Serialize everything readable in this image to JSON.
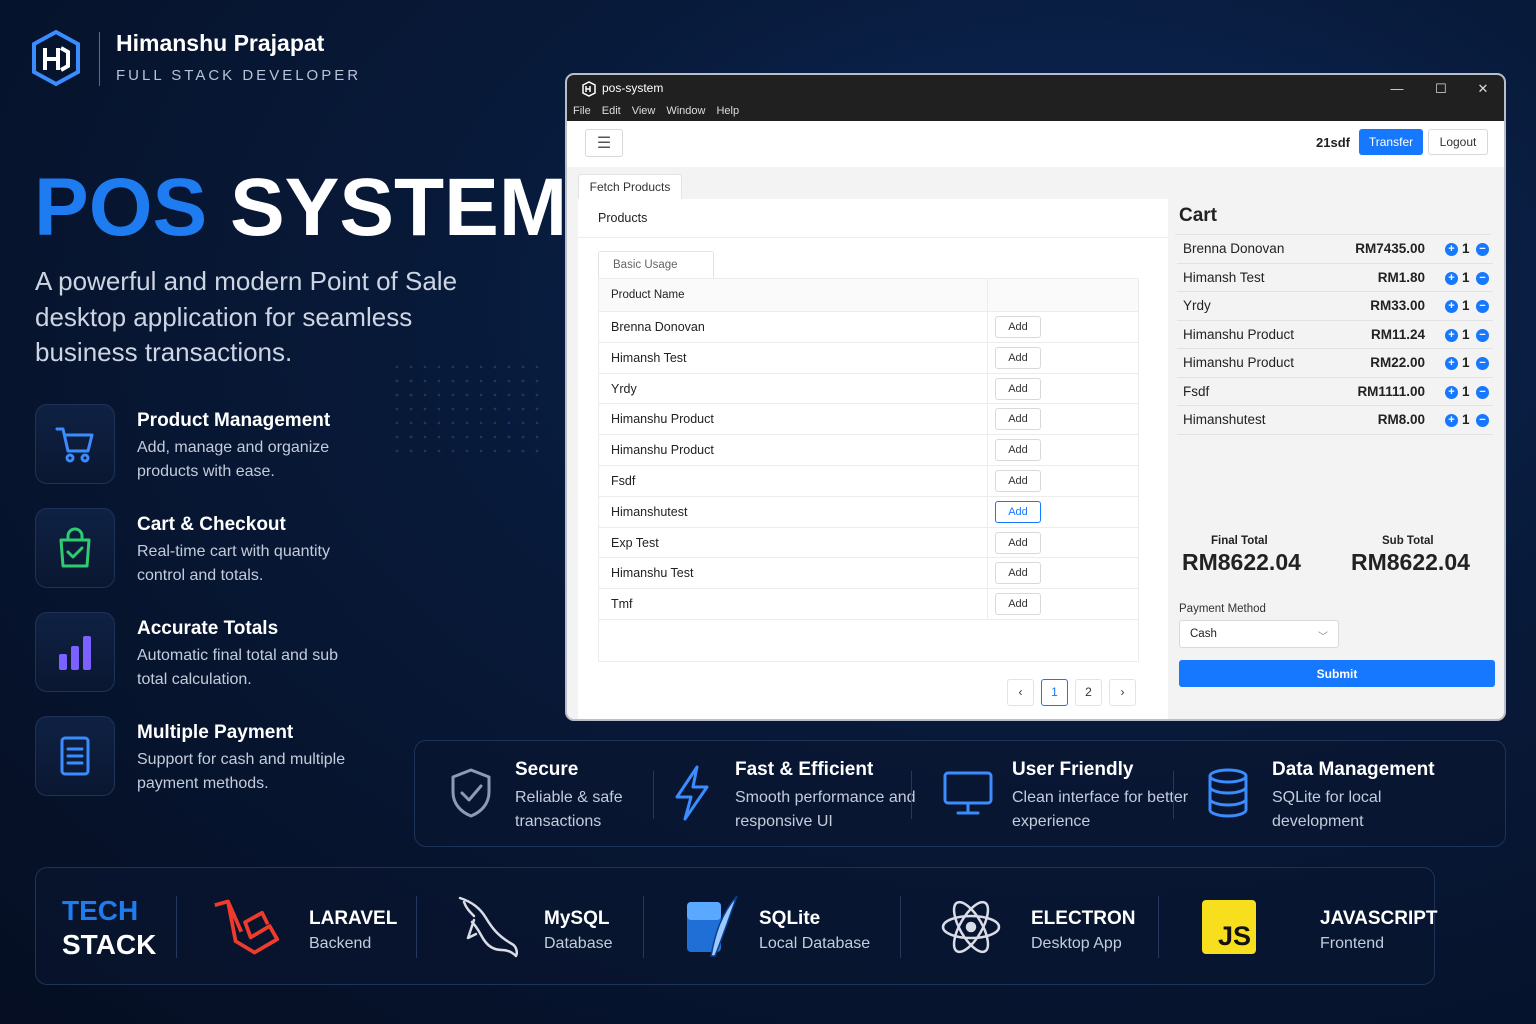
{
  "brand": {
    "name": "Himanshu Prajapat",
    "role": "FULL STACK DEVELOPER"
  },
  "hero": {
    "title_accent": "POS",
    "title_rest": "SYSTEM",
    "description": "A powerful and modern Point of Sale desktop application for seamless business transactions."
  },
  "features": [
    {
      "icon": "cart-icon",
      "title": "Product Management",
      "desc": "Add, manage and organize products with ease."
    },
    {
      "icon": "shopping-bag-check-icon",
      "title": "Cart & Checkout",
      "desc": "Real-time cart with quantity control and totals."
    },
    {
      "icon": "bar-chart-icon",
      "title": "Accurate Totals",
      "desc": "Automatic final total and sub total calculation."
    },
    {
      "icon": "document-icon",
      "title": "Multiple Payment",
      "desc": "Support for cash and multiple payment methods."
    }
  ],
  "window": {
    "title": "pos-system",
    "menu": [
      "File",
      "Edit",
      "View",
      "Window",
      "Help"
    ],
    "controls": {
      "minimize": "—",
      "maximize": "☐",
      "close": "✕"
    },
    "user": "21sdf",
    "transfer_label": "Transfer",
    "logout_label": "Logout",
    "tab_label": "Fetch Products",
    "products_heading": "Products",
    "table_tab": "Basic Usage",
    "column_header": "Product Name",
    "add_label": "Add",
    "products": [
      "Brenna Donovan",
      "Himansh Test",
      "Yrdy",
      "Himanshu Product",
      "Himanshu Product",
      "Fsdf",
      "Himanshutest",
      "Exp Test",
      "Himanshu Test",
      "Tmf"
    ],
    "pagination": {
      "prev": "‹",
      "pages": [
        "1",
        "2"
      ],
      "current": "1",
      "next": "›"
    },
    "cart": {
      "title": "Cart",
      "items": [
        {
          "name": "Brenna Donovan",
          "price": "RM7435.00",
          "qty": "1"
        },
        {
          "name": "Himansh Test",
          "price": "RM1.80",
          "qty": "1"
        },
        {
          "name": "Yrdy",
          "price": "RM33.00",
          "qty": "1"
        },
        {
          "name": "Himanshu Product",
          "price": "RM11.24",
          "qty": "1"
        },
        {
          "name": "Himanshu Product",
          "price": "RM22.00",
          "qty": "1"
        },
        {
          "name": "Fsdf",
          "price": "RM1111.00",
          "qty": "1"
        },
        {
          "name": "Himanshutest",
          "price": "RM8.00",
          "qty": "1"
        }
      ],
      "final_total_label": "Final Total",
      "final_total": "RM8622.04",
      "sub_total_label": "Sub Total",
      "sub_total": "RM8622.04",
      "payment_label": "Payment Method",
      "payment_value": "Cash",
      "submit_label": "Submit"
    }
  },
  "highlights": [
    {
      "icon": "shield-check-icon",
      "title": "Secure",
      "desc": "Reliable & safe transactions"
    },
    {
      "icon": "lightning-icon",
      "title": "Fast & Efficient",
      "desc": "Smooth performance and responsive UI"
    },
    {
      "icon": "monitor-icon",
      "title": "User Friendly",
      "desc": "Clean interface for better experience"
    },
    {
      "icon": "database-icon",
      "title": "Data Management",
      "desc": "SQLite for local development"
    }
  ],
  "tech_stack": {
    "heading_1": "TECH",
    "heading_2": "STACK",
    "items": [
      {
        "icon": "laravel-logo-icon",
        "name": "LARAVEL",
        "sub": "Backend"
      },
      {
        "icon": "mysql-dolphin-icon",
        "name": "MySQL",
        "sub": "Database"
      },
      {
        "icon": "sqlite-logo-icon",
        "name": "SQLite",
        "sub": "Local Database"
      },
      {
        "icon": "electron-atom-icon",
        "name": "ELECTRON",
        "sub": "Desktop App"
      },
      {
        "icon": "javascript-logo-icon",
        "name": "JAVASCRIPT",
        "sub": "Frontend",
        "logo_text": "JS"
      }
    ]
  },
  "colors": {
    "accent": "#1e7bf0",
    "button": "#1677ff",
    "background": "#071530"
  }
}
